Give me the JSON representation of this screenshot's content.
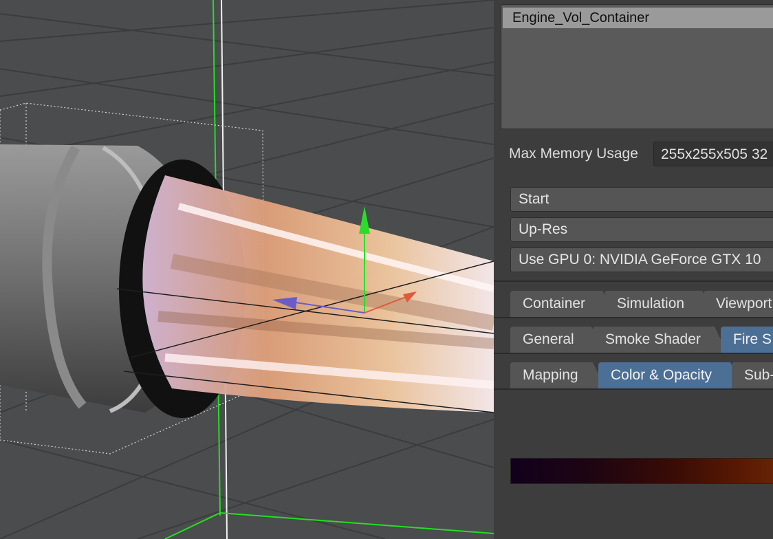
{
  "objects": {
    "selected": "Engine_Vol_Container"
  },
  "memory": {
    "label": "Max Memory Usage",
    "value": "255x255x505 32"
  },
  "buttons": {
    "start": "Start",
    "upres": "Up-Res",
    "gpu": "Use GPU 0: NVIDIA GeForce GTX 10"
  },
  "tabs_main": [
    {
      "label": "Container",
      "active": false
    },
    {
      "label": "Simulation",
      "active": false
    },
    {
      "label": "Viewport",
      "active": false
    }
  ],
  "tabs_shader": [
    {
      "label": "General",
      "active": false
    },
    {
      "label": "Smoke Shader",
      "active": false
    },
    {
      "label": "Fire S",
      "active": true
    }
  ],
  "tabs_sub": [
    {
      "label": "Mapping",
      "active": false
    },
    {
      "label": "Color & Opacity",
      "active": true
    },
    {
      "label": "Sub-",
      "active": false
    }
  ],
  "gradient": {
    "colors": [
      "#12001c",
      "#3a0c05",
      "#6a2606"
    ]
  }
}
